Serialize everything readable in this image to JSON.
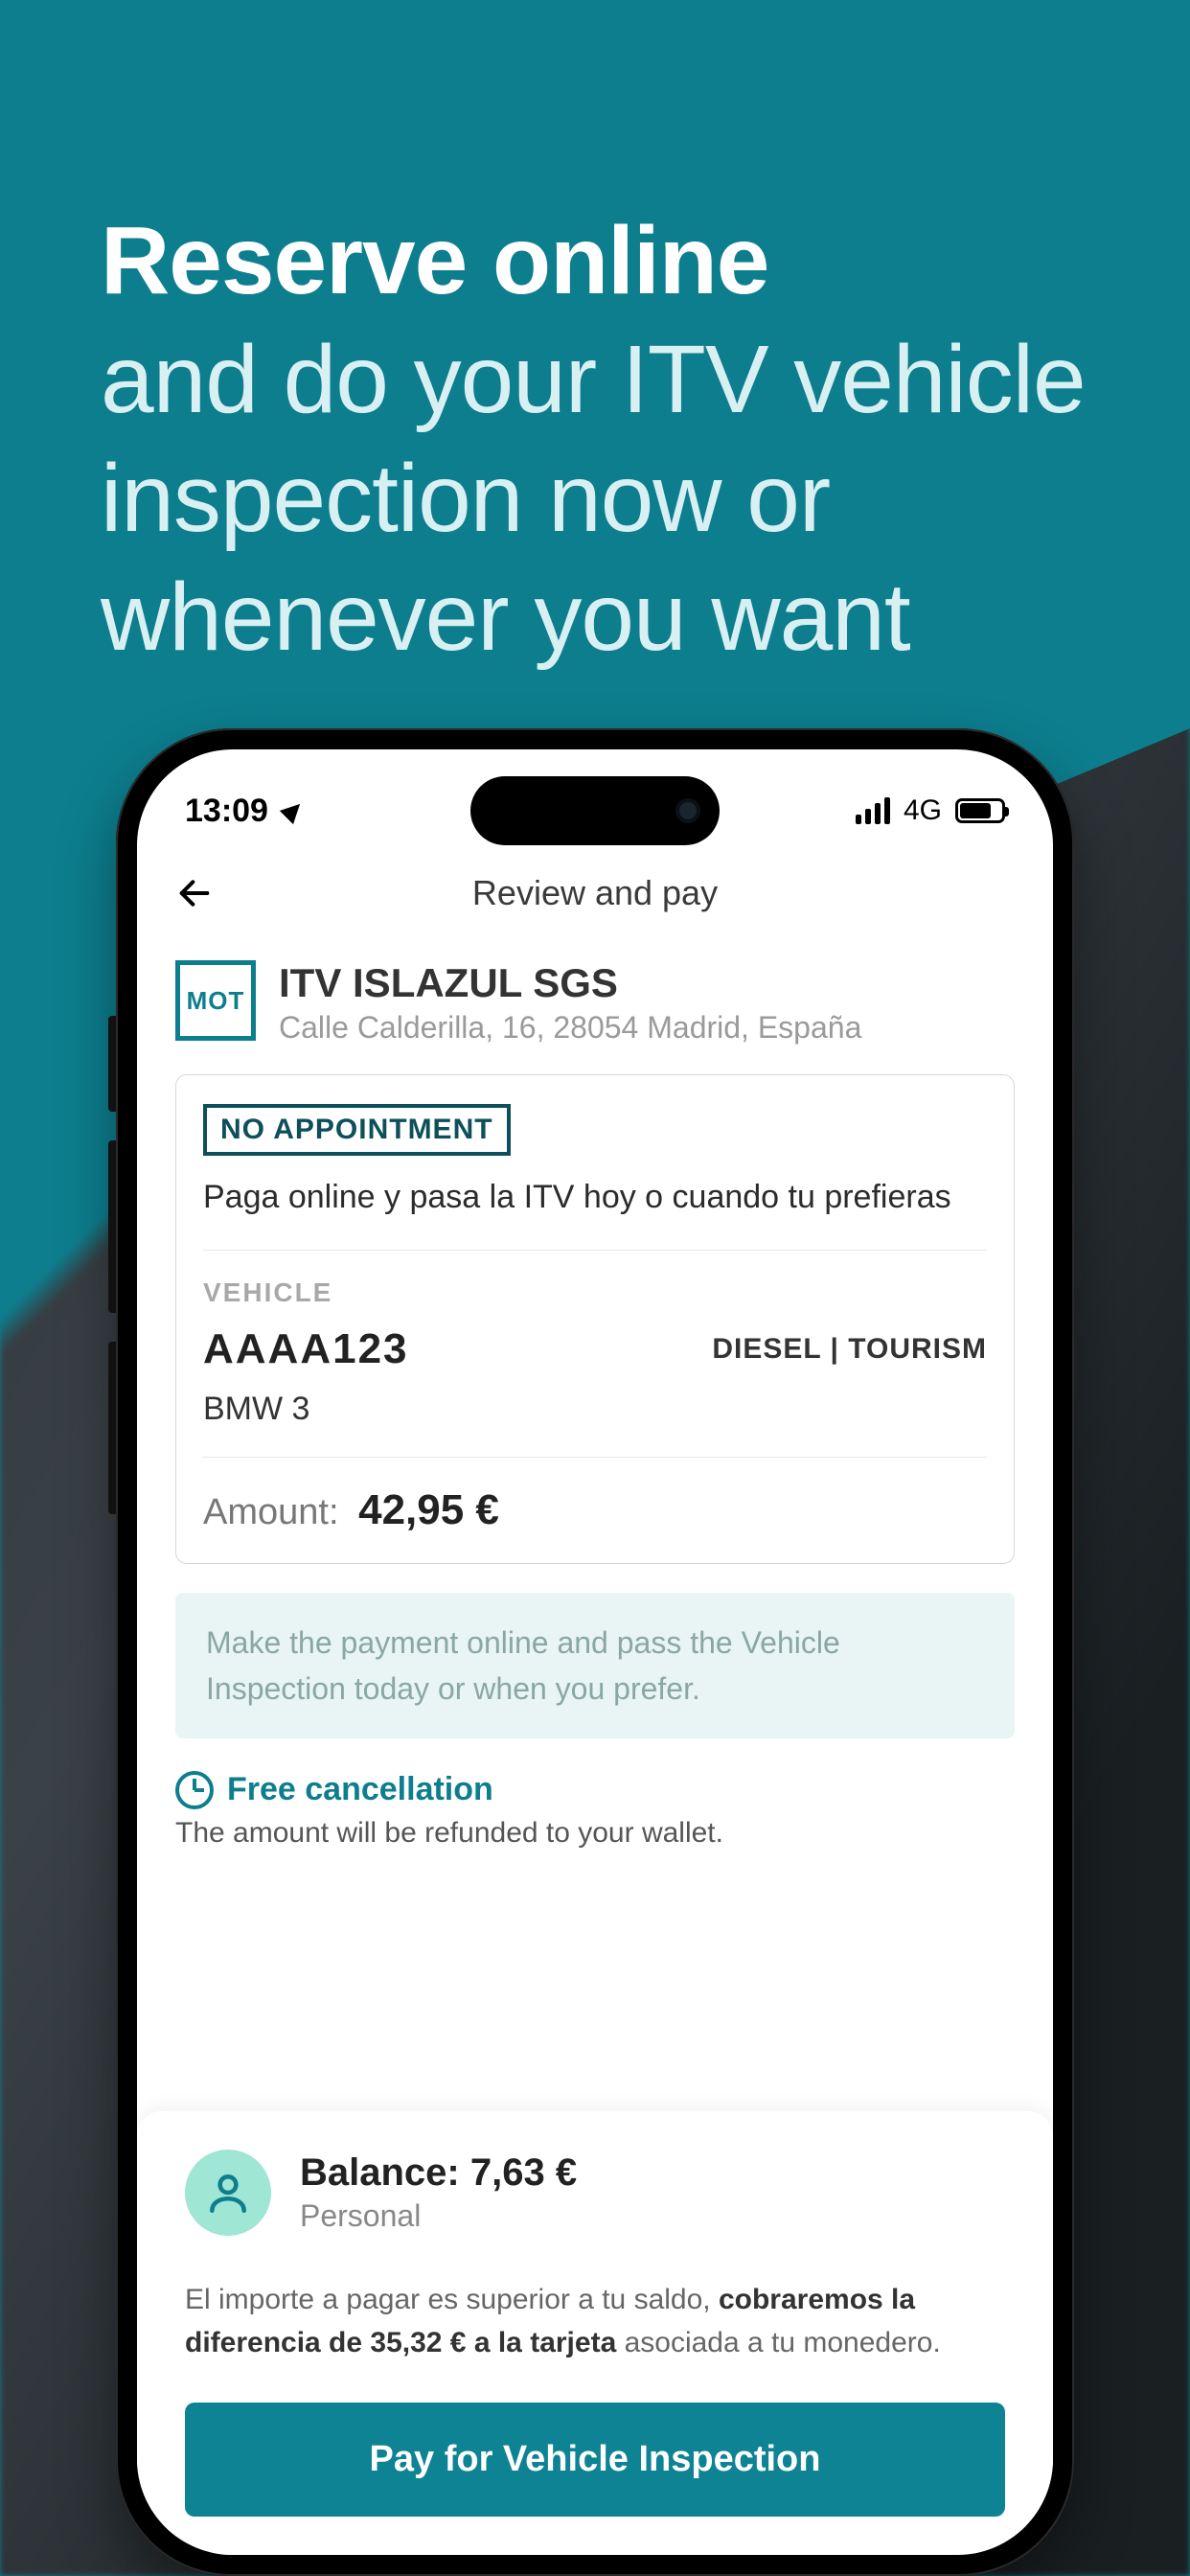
{
  "headline": {
    "bold": "Reserve online",
    "rest": "and do your ITV vehicle inspection now or whenever you want"
  },
  "status": {
    "time": "13:09",
    "network_label": "4G"
  },
  "nav": {
    "title": "Review and pay"
  },
  "station": {
    "badge": "MOT",
    "name": "ITV ISLAZUL SGS",
    "address": "Calle Calderilla, 16, 28054 Madrid, España"
  },
  "booking": {
    "no_appointment_label": "NO APPOINTMENT",
    "description": "Paga online y pasa la ITV hoy o cuando tu prefieras",
    "vehicle_label": "VEHICLE",
    "plate": "AAAA123",
    "fuel_type": "DIESEL | TOURISM",
    "model": "BMW 3",
    "amount_label": "Amount:",
    "amount_value": "42,95 €"
  },
  "info_banner": "Make the payment online and pass the Vehicle Inspection today or when you prefer.",
  "cancellation": {
    "title": "Free cancellation",
    "subtitle": "The amount will be refunded to your wallet."
  },
  "wallet": {
    "balance_label": "Balance:",
    "balance_value": "7,63 €",
    "account_label": "Personal",
    "note_prefix": "El importe a pagar es superior a tu saldo, ",
    "note_bold": "cobraremos la diferencia de 35,32 € a la tarjeta",
    "note_suffix": " asociada a tu monedero."
  },
  "cta": {
    "pay_label": "Pay for Vehicle Inspection"
  }
}
